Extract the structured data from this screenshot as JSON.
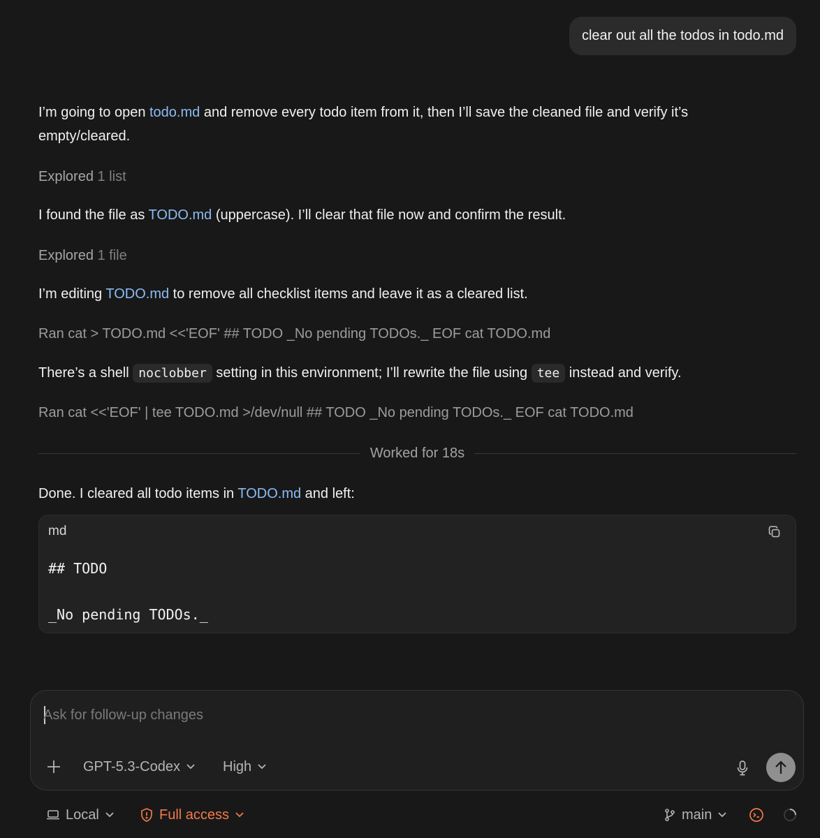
{
  "user_message": "clear out all the todos in todo.md",
  "assistant": {
    "p1": {
      "before": "I’m going to open ",
      "link": "todo.md",
      "after": " and remove every todo item from it, then I’ll save the cleaned file and verify it’s empty/cleared."
    },
    "explored1": {
      "label": "Explored",
      "detail": "1 list"
    },
    "p2": {
      "before": "I found the file as ",
      "link": "TODO.md",
      "after": " (uppercase). I’ll clear that file now and confirm the result."
    },
    "explored2": {
      "label": "Explored",
      "detail": "1 file"
    },
    "p3": {
      "before": "I’m editing ",
      "link": "TODO.md",
      "after": " to remove all checklist items and leave it as a cleared list."
    },
    "ran1": "Ran cat > TODO.md <<'EOF' ## TODO _No pending TODOs._ EOF cat TODO.md",
    "p4": {
      "before": "There’s a shell ",
      "code1": "noclobber",
      "middle": " setting in this environment; I’ll rewrite the file using ",
      "code2": "tee",
      "after": " instead and verify."
    },
    "ran2": "Ran cat <<'EOF' | tee TODO.md >/dev/null ## TODO _No pending TODOs._ EOF cat TODO.md",
    "worked_for": "Worked for 18s",
    "p5": {
      "before": "Done. I cleared all todo items in ",
      "link": "TODO.md",
      "after": " and left:"
    },
    "codeblock": {
      "lang": "md",
      "lines": [
        "## TODO",
        "",
        "_No pending TODOs._"
      ]
    }
  },
  "composer": {
    "placeholder": "Ask for follow-up changes",
    "model": "GPT-5.3-Codex",
    "effort": "High"
  },
  "statusbar": {
    "environment": "Local",
    "access": "Full access",
    "branch": "main"
  },
  "colors": {
    "background": "#181818",
    "link": "#8bbcf4",
    "access_warning": "#f07a4a"
  }
}
